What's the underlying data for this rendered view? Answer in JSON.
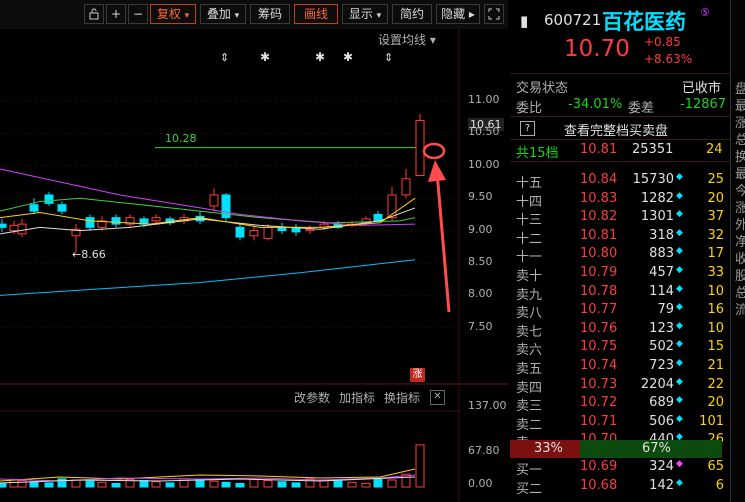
{
  "toolbar": {
    "buttons": [
      "复权",
      "叠加",
      "筹码",
      "画线",
      "显示",
      "简约",
      "隐藏"
    ],
    "highlighted": [
      "复权",
      "画线"
    ]
  },
  "chart": {
    "ma_setting_label": "设置均线",
    "price_ticks": [
      "11.00",
      "10.61",
      "10.50",
      "10.00",
      "9.50",
      "9.00",
      "8.50",
      "8.00",
      "7.50"
    ],
    "current_price_tag": "10.61",
    "ref_line_label": "10.28",
    "low_label": "8.66",
    "limit_up_badge": "涨",
    "indicator_toolbar": [
      "改参数",
      "加指标",
      "换指标"
    ],
    "volume_ticks": [
      "137.00",
      "67.80",
      "0.00"
    ]
  },
  "quote": {
    "code": "600721",
    "name": "百花医药",
    "badge": "⑤",
    "price": "10.70",
    "change": "+0.85",
    "change_pct": "+8.63%",
    "trade_status_label": "交易状态",
    "trade_status_value": "已收市",
    "wei_bi_label": "委比",
    "wei_bi_value": "-34.01%",
    "wei_cha_label": "委差",
    "wei_cha_value": "-12867",
    "full_book_label": "查看完整档买卖盘",
    "help_icon": "?",
    "total_levels_label": "共15档",
    "total_levels_price": "10.81",
    "total_levels_volume": "25351",
    "total_levels_count": "24",
    "asks": [
      {
        "label": "十五",
        "price": "10.84",
        "volume": "15730",
        "count": "25"
      },
      {
        "label": "十四",
        "price": "10.83",
        "volume": "1282",
        "count": "20"
      },
      {
        "label": "十三",
        "price": "10.82",
        "volume": "1301",
        "count": "37"
      },
      {
        "label": "十二",
        "price": "10.81",
        "volume": "318",
        "count": "32"
      },
      {
        "label": "十一",
        "price": "10.80",
        "volume": "883",
        "count": "17"
      },
      {
        "label": "卖十",
        "price": "10.79",
        "volume": "457",
        "count": "33"
      },
      {
        "label": "卖九",
        "price": "10.78",
        "volume": "114",
        "count": "10"
      },
      {
        "label": "卖八",
        "price": "10.77",
        "volume": "79",
        "count": "16"
      },
      {
        "label": "卖七",
        "price": "10.76",
        "volume": "123",
        "count": "10"
      },
      {
        "label": "卖六",
        "price": "10.75",
        "volume": "502",
        "count": "15"
      },
      {
        "label": "卖五",
        "price": "10.74",
        "volume": "723",
        "count": "21"
      },
      {
        "label": "卖四",
        "price": "10.73",
        "volume": "2204",
        "count": "22"
      },
      {
        "label": "卖三",
        "price": "10.72",
        "volume": "689",
        "count": "20"
      },
      {
        "label": "卖二",
        "price": "10.71",
        "volume": "506",
        "count": "101"
      },
      {
        "label": "卖一",
        "price": "10.70",
        "volume": "440",
        "count": "26"
      }
    ],
    "ratio_sell": "33%",
    "ratio_buy": "67%",
    "bids": [
      {
        "label": "买一",
        "price": "10.69",
        "volume": "324",
        "count": "65"
      },
      {
        "label": "买二",
        "price": "10.68",
        "volume": "142",
        "count": "6"
      }
    ]
  },
  "edge_chars": [
    "盘",
    "最",
    "涨",
    "总",
    "换",
    "最",
    "今",
    "涨",
    "外",
    "净",
    "收",
    "股",
    "总",
    "流"
  ],
  "colors": {
    "up": "#ff3a3a",
    "down": "#00e0ff",
    "accent": "#ff6a3a",
    "arrow": "#ff4d4d"
  }
}
